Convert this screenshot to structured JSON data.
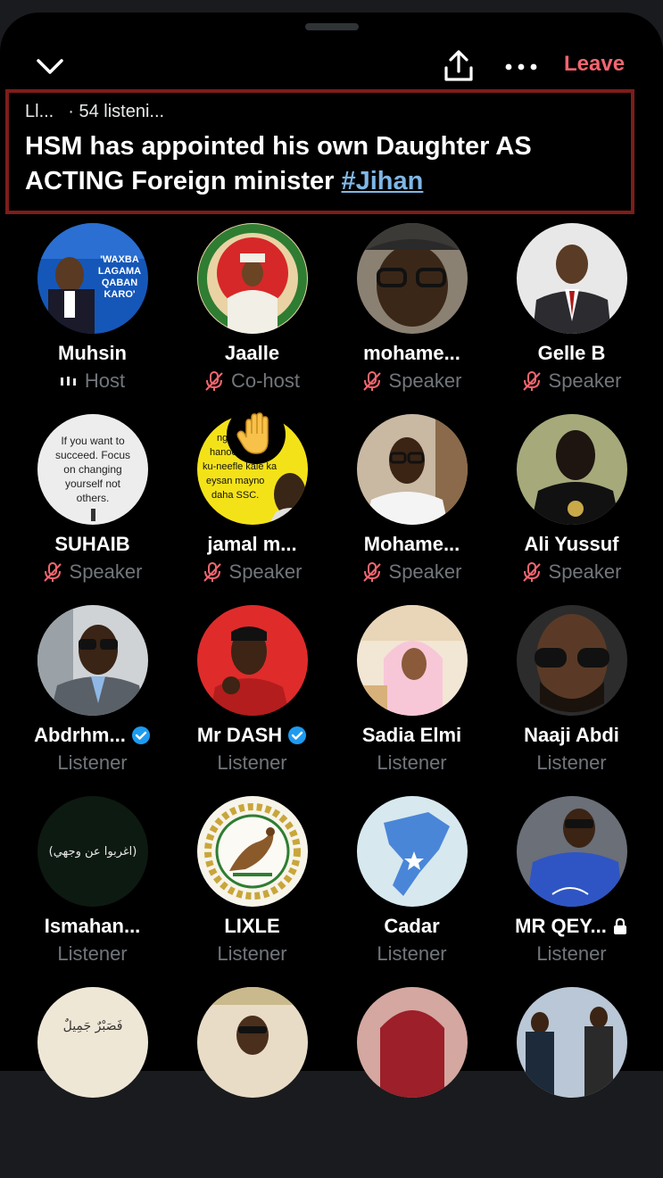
{
  "topbar": {
    "leave_label": "Leave"
  },
  "space": {
    "host_label": "Ll...",
    "listeners": "· 54 listeni...",
    "title": "HSM has appointed his own Daughter AS ACTING Foreign minister ",
    "hashtag": "#Jihan"
  },
  "participants": [
    {
      "name": "Muhsin",
      "role": "Host"
    },
    {
      "name": "Jaalle",
      "role": "Co-host"
    },
    {
      "name": "mohame...",
      "role": "Speaker"
    },
    {
      "name": "Gelle B",
      "role": "Speaker"
    },
    {
      "name": "SUHAIB",
      "role": "Speaker",
      "avatar_text": [
        "If you want to",
        "succeed. Focus",
        "on changing",
        "yourself not",
        "others."
      ]
    },
    {
      "name": "jamal m...",
      "role": "Speaker",
      "avatar_text": [
        "ngiriis taba",
        "hanoo yimaad",
        "ku-neefle kale ka",
        "eysan mayno",
        "daha SSC."
      ]
    },
    {
      "name": "Mohame...",
      "role": "Speaker"
    },
    {
      "name": "Ali Yussuf",
      "role": "Speaker"
    },
    {
      "name": "Abdrhm...",
      "role": "Listener"
    },
    {
      "name": "Mr DASH",
      "role": "Listener"
    },
    {
      "name": "Sadia Elmi",
      "role": "Listener"
    },
    {
      "name": "Naaji Abdi",
      "role": "Listener"
    },
    {
      "name": "Ismahan...",
      "role": "Listener",
      "avatar_text": [
        "(اغربوا عن وجهي)"
      ]
    },
    {
      "name": "LIXLE",
      "role": "Listener"
    },
    {
      "name": "Cadar",
      "role": "Listener"
    },
    {
      "name": "MR QEY...",
      "role": "Listener"
    }
  ],
  "muhsin_avatar_text": [
    "'WAXBA",
    "LAGAMA",
    "QABAN",
    "KARO'"
  ],
  "partial_avatar_text": "فَصَبْرٌ جَمِيلٌ",
  "colors": {
    "accent_red": "#f4656f",
    "muted": "#71767b",
    "verified": "#1d9bf0",
    "title_border": "#7d1d1a",
    "hashtag": "#7fb7e6"
  }
}
